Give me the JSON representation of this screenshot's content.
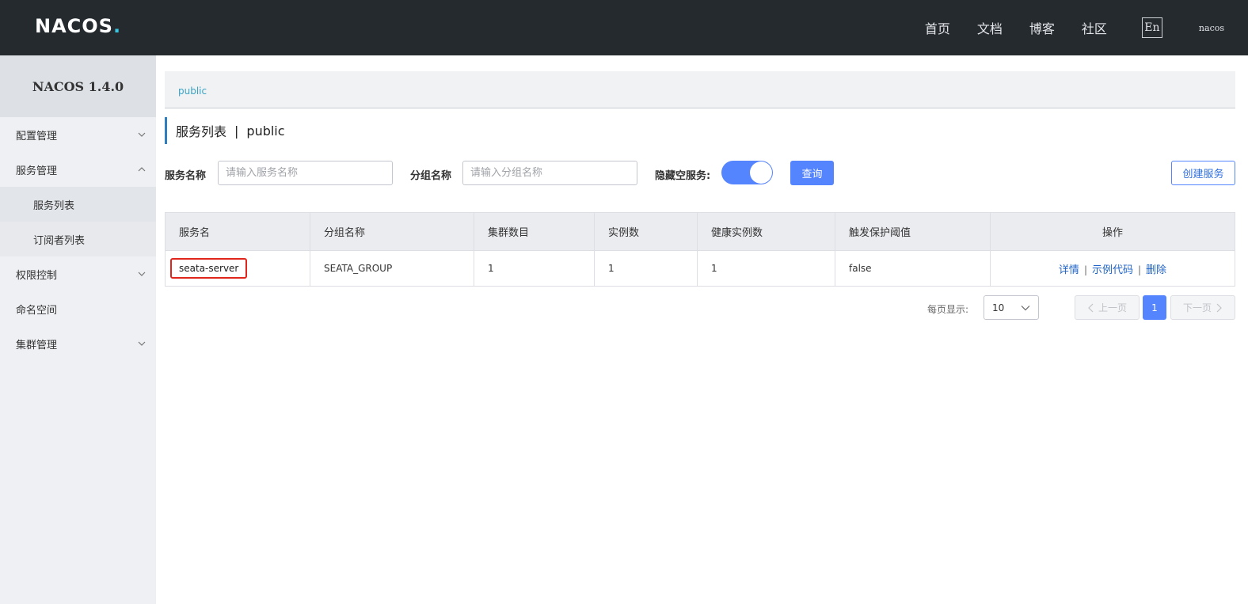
{
  "header": {
    "logo": "NACOS",
    "logo_dot": ".",
    "nav": [
      "首页",
      "文档",
      "博客",
      "社区"
    ],
    "lang_button": "En",
    "user": "nacos"
  },
  "sidebar": {
    "title": "NACOS 1.4.0",
    "items": [
      {
        "label": "配置管理"
      },
      {
        "label": "服务管理"
      },
      {
        "label": "服务列表"
      },
      {
        "label": "订阅者列表"
      },
      {
        "label": "权限控制"
      },
      {
        "label": "命名空间"
      },
      {
        "label": "集群管理"
      }
    ]
  },
  "breadcrumb": {
    "namespace": "public"
  },
  "page_title": {
    "main": "服务列表",
    "separator": "|",
    "namespace": "public"
  },
  "filters": {
    "service_label": "服务名称",
    "service_placeholder": "请输入服务名称",
    "group_label": "分组名称",
    "group_placeholder": "请输入分组名称",
    "hide_empty_label": "隐藏空服务:",
    "hide_empty_on": true,
    "query_button": "查询",
    "create_button": "创建服务"
  },
  "table": {
    "headers": [
      "服务名",
      "分组名称",
      "集群数目",
      "实例数",
      "健康实例数",
      "触发保护阈值",
      "操作"
    ],
    "rows": [
      {
        "name": "seata-server",
        "group": "SEATA_GROUP",
        "clusters": "1",
        "instances": "1",
        "healthy": "1",
        "threshold": "false",
        "ops": [
          "详情",
          "示例代码",
          "删除"
        ]
      }
    ],
    "op_separator": "|"
  },
  "pagination": {
    "page_size_label": "每页显示:",
    "page_size": "10",
    "prev": "上一页",
    "current": "1",
    "next": "下一页"
  },
  "colors": {
    "topbar": "#252a2f",
    "primary": "#5584ff",
    "highlight": "#e0261c",
    "link": "#1f63c9"
  }
}
